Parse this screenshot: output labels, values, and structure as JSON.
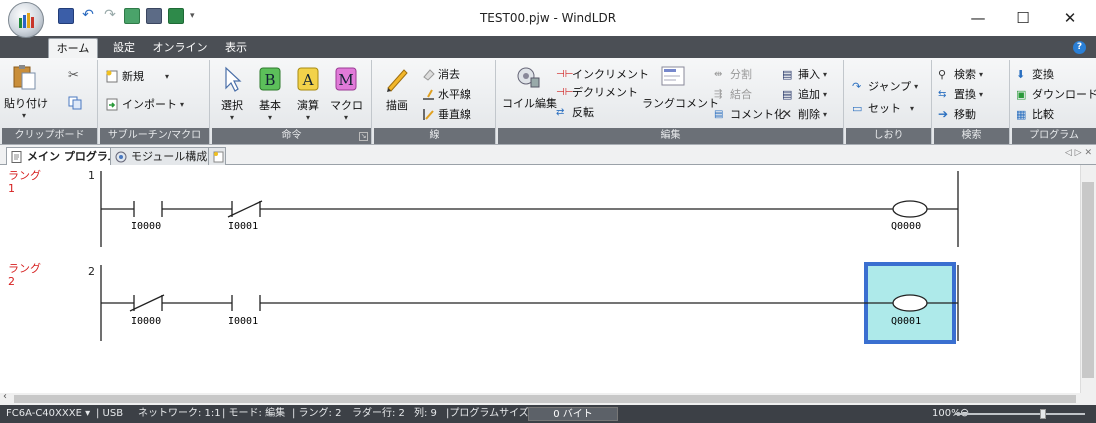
{
  "window": {
    "title": "TEST00.pjw - WindLDR",
    "minimize": "—",
    "maximize": "☐",
    "close": "✕"
  },
  "ribbon_tabs": [
    "ホーム",
    "設定",
    "オンライン",
    "表示"
  ],
  "active_tab": "ホーム",
  "groups": {
    "clipboard": {
      "label": "クリップボード",
      "paste": "貼り付け",
      "paste_dropdown": "▾"
    },
    "subroutine": {
      "label": "サブルーチン/マクロ",
      "new": "新規",
      "import": "インポート"
    },
    "instruction": {
      "label": "命令",
      "select": "選択",
      "basic": "基本",
      "advanced": "演算",
      "macro": "マクロ"
    },
    "line": {
      "label": "線",
      "draw": "描画",
      "erase": "消去",
      "horizontal": "水平線",
      "vertical": "垂直線"
    },
    "edit": {
      "label": "編集",
      "coil_edit": "コイル編集",
      "increment": "インクリメント",
      "decrement": "デクリメント",
      "reverse": "反転",
      "rung_comment": "ラングコメント",
      "split": "分割",
      "join": "結合",
      "comment_out": "コメント化",
      "insert": "挿入",
      "append": "追加",
      "delete": "削除"
    },
    "bookmark": {
      "label": "しおり",
      "jump": "ジャンプ",
      "set": "セット"
    },
    "search": {
      "label": "検索",
      "find": "検索",
      "replace": "置換",
      "move": "移動"
    },
    "program": {
      "label": "プログラム",
      "convert": "変換",
      "download": "ダウンロード",
      "compare": "比較"
    }
  },
  "doc_tabs": [
    "メイン プログラム",
    "モジュール構成"
  ],
  "rungs": [
    {
      "label_line1": "ラング",
      "label_line2": "1",
      "number": "1",
      "contact1": "I0000",
      "contact2": "I0001",
      "coil": "Q0000"
    },
    {
      "label_line1": "ラング",
      "label_line2": "2",
      "number": "2",
      "contact1": "I0000",
      "contact2": "I0001",
      "coil": "Q0001"
    }
  ],
  "status": {
    "plc": "FC6A-C40XXXE  ▾",
    "comm": "| USB",
    "network": "ネットワーク: 1:1",
    "mode": "| モード: 編集",
    "rungs": "| ラング: 2",
    "ladder_rows": "ラダー行: 2",
    "column": "列: 9",
    "program_size_label": "|プログラムサイズ:",
    "program_size": "0 バイト",
    "zoom": "100%"
  },
  "colors": {
    "rung_label": "#d62020",
    "selection_fill": "#aeeaea",
    "selection_border": "#3a6fd0",
    "ribbon_dark": "#4b4f55"
  }
}
